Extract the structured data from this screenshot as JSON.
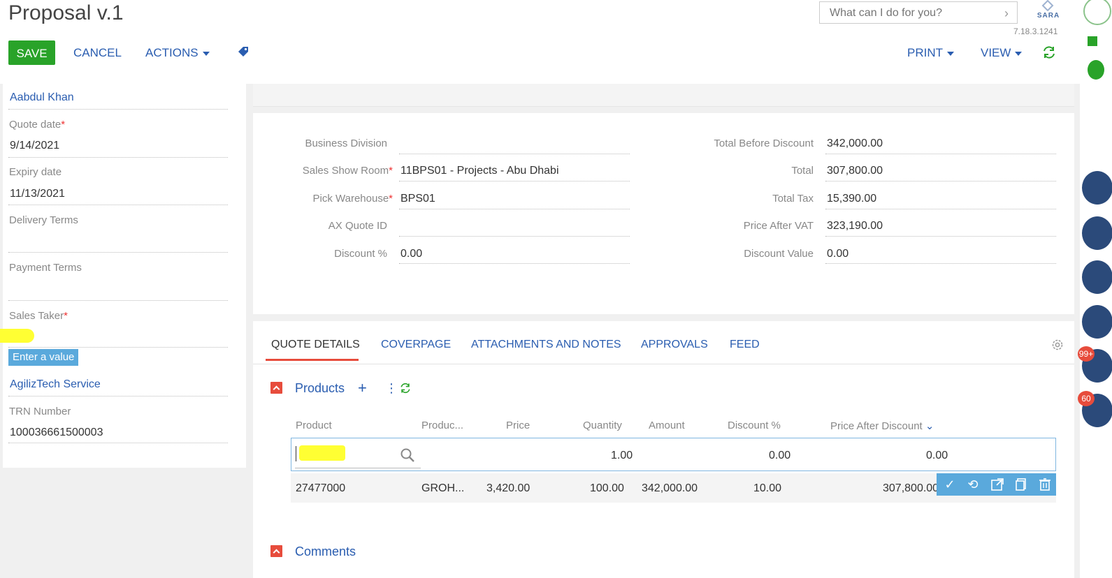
{
  "header": {
    "title": "Proposal v.1",
    "save_label": "SAVE",
    "cancel_label": "CANCEL",
    "actions_label": "ACTIONS",
    "print_label": "PRINT",
    "view_label": "VIEW",
    "search_placeholder": "What can I do for you?",
    "brand": "SARA",
    "version": "7.18.3.1241"
  },
  "left_fields": {
    "contact": "Aabdul Khan",
    "quote_date_label": "Quote date",
    "quote_date_value": "9/14/2021",
    "expiry_date_label": "Expiry date",
    "expiry_date_value": "11/13/2021",
    "delivery_terms_label": "Delivery Terms",
    "payment_terms_label": "Payment Terms",
    "sales_taker_label": "Sales Taker",
    "validation_tooltip": "Enter a value",
    "owner_value": "AgilizTech Service",
    "trn_label": "TRN Number",
    "trn_value": "100036661500003",
    "required_mark": "*"
  },
  "details": {
    "business_division_label": "Business Division",
    "business_division_value": "",
    "sales_show_room_label": "Sales Show Room",
    "sales_show_room_value": "11BPS01 - Projects - Abu Dhabi",
    "pick_warehouse_label": "Pick Warehouse",
    "pick_warehouse_value": "BPS01",
    "ax_quote_id_label": "AX Quote ID",
    "ax_quote_id_value": "",
    "discount_pct_label": "Discount %",
    "discount_pct_value": "0.00",
    "total_before_discount_label": "Total Before Discount",
    "total_before_discount_value": "342,000.00",
    "total_label": "Total",
    "total_value": "307,800.00",
    "total_tax_label": "Total Tax",
    "total_tax_value": "15,390.00",
    "price_after_vat_label": "Price After VAT",
    "price_after_vat_value": "323,190.00",
    "discount_value_label": "Discount Value",
    "discount_value_value": "0.00"
  },
  "tabs": [
    {
      "label": "QUOTE DETAILS"
    },
    {
      "label": "COVERPAGE"
    },
    {
      "label": "ATTACHMENTS AND NOTES"
    },
    {
      "label": "APPROVALS"
    },
    {
      "label": "FEED"
    }
  ],
  "products": {
    "section_title": "Products",
    "columns": [
      "Product",
      "Produc...",
      "Price",
      "Quantity",
      "Amount",
      "Discount %",
      "Price After Discount"
    ],
    "edit_row": {
      "quantity": "1.00",
      "discount": "0.00",
      "price_after_discount": "0.00"
    },
    "rows": [
      {
        "product": "27477000",
        "product_name": "GROH...",
        "price": "3,420.00",
        "quantity": "100.00",
        "amount": "342,000.00",
        "discount": "10.00",
        "price_after_discount": "307,800.00"
      }
    ]
  },
  "comments": {
    "section_title": "Comments"
  },
  "side_badges": {
    "notifications": "99+",
    "tasks": "60"
  },
  "colors": {
    "save": "#29a329",
    "link": "#2a5db0",
    "accent_red": "#e74c3c",
    "sidebar_dark": "#2b4a7a",
    "row_actions": "#4aa3df"
  }
}
